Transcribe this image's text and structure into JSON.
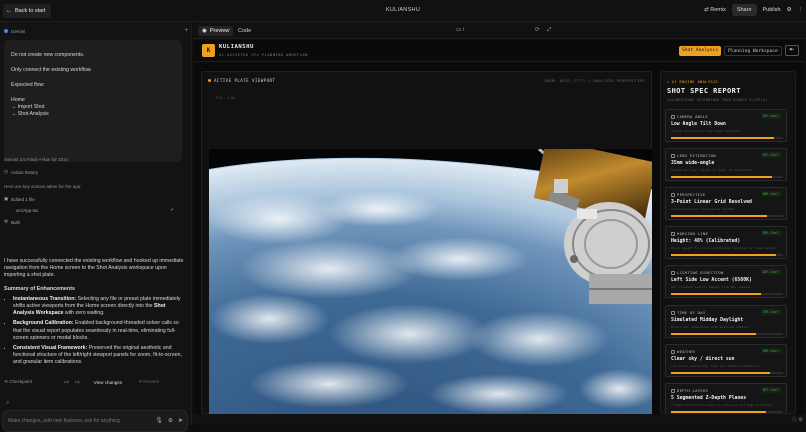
{
  "topbar": {
    "back_label": "Back to start",
    "title": "KULIANSHU",
    "remix": "Remix",
    "share": "Share",
    "publish": "Publish"
  },
  "chat": {
    "model_tag": "Gemini",
    "user_message": [
      "Do not create new components.",
      "Only connect the existing workflow.",
      "Expected flow:",
      "Home",
      "→ Import Shot",
      "→ Shot Analysis"
    ],
    "model_line": "Gemini 3.5 Flash  •  Ran for 101s",
    "action_history": "Action history",
    "actions_note": "Here are key actions taken for the app:",
    "edited_label": "Edited 1 file",
    "edited_file": "src/App.tsx",
    "built_label": "Built",
    "response_intro": "I have successfully connected the existing workflow and hooked up immediate navigation from the Home screen to the Shot Analysis workspace upon importing a shot plate.",
    "summary_heading": "Summary of Enhancements",
    "bullets": [
      {
        "title": "Instantaneous Transition:",
        "pre": " Selecting any file or preset plate immediately shifts active viewports from the Home screen directly into the ",
        "bold": "Shot Analysis Workspace",
        "post": " with zero waiting."
      },
      {
        "title": "Background Calibration:",
        "pre": " Enabled background-threaded solver calls so that the visual report populates seamlessly in real-time, eliminating full-screen spinners or modal blocks.",
        "bold": "",
        "post": ""
      },
      {
        "title": "Consistent Visual Framework:",
        "pre": " Preserved the original aesthetic and functional structure of the left/right viewport panels for zoom, fit-to-screen, and granular item calibrations.",
        "bold": "",
        "post": ""
      }
    ],
    "checkpoint": "Checkpoint",
    "view_changes": "View changes",
    "restore": "Restore",
    "input_placeholder": "Make changes, add new features, ask for anything"
  },
  "preview": {
    "tab_preview": "Preview",
    "tab_code": "Code",
    "path": "/"
  },
  "app": {
    "logo": "K",
    "brand": "KULIANSHU",
    "brand_sub": "AI-ASSISTED VFX PLANNING WORKFLOW",
    "mode_active": "Shot Analysis",
    "mode_other": "Planning Workspace",
    "viewport_title": "ACTIVE PLATE VIEWPORT",
    "viewport_meta": "ZOOM: AUTO (FIT)  |  ANALYZED PERSPECTIVE",
    "viewport_coord": "FIG. 1.01",
    "report_tag": "AI ENGINE ANALYSIS",
    "report_title": "SHOT SPEC REPORT",
    "report_sub": "CALIBRATIONS DETERMINED FROM SOURCE PLATE(S)",
    "cards": [
      {
        "label": "CAMERA ANGLE",
        "value": "Low Angle Tilt Down",
        "desc": "Slight low-horizon tilt angle detected",
        "conf": "94% Conf.",
        "level": 0.92
      },
      {
        "label": "LENS ESTIMATION",
        "value": "35mm wide-angle",
        "desc": "Recovered focal length on Super 35 equivalent",
        "conf": "91% Conf.",
        "level": 0.9
      },
      {
        "label": "PERSPECTIVE",
        "value": "3-Point Linear Grid Resolved",
        "desc": "Vanishing point convergence located",
        "conf": "88% Conf.",
        "level": 0.86
      },
      {
        "label": "HORIZON LINE",
        "value": "Height: 48% (Calibrated)",
        "desc": "Pixel height to solve coordinates relative to frame height",
        "conf": "95% Conf.",
        "level": 0.94
      },
      {
        "label": "LIGHTING DIRECTION",
        "value": "Left Side Low Accent (6500K)",
        "desc": "All incident vectors mapped from key shadows",
        "conf": "82% Conf.",
        "level": 0.8
      },
      {
        "label": "TIME OF DAY",
        "value": "Simulated Midday Daylight",
        "desc": "Direct sun simulation with balanced shadows",
        "conf": "78% Conf.",
        "level": 0.76
      },
      {
        "label": "WEATHER",
        "value": "Clear sky / direct sun",
        "desc": "Low cloud scattering, high sky radiance dispersion",
        "conf": "90% Conf.",
        "level": 0.88
      },
      {
        "label": "DEPTH LAYERS",
        "value": "5 Segmented Z-Depth Planes",
        "desc": "Z-depth extraction based on occlusion and edge proximity",
        "conf": "87% Conf.",
        "level": 0.85
      }
    ]
  }
}
